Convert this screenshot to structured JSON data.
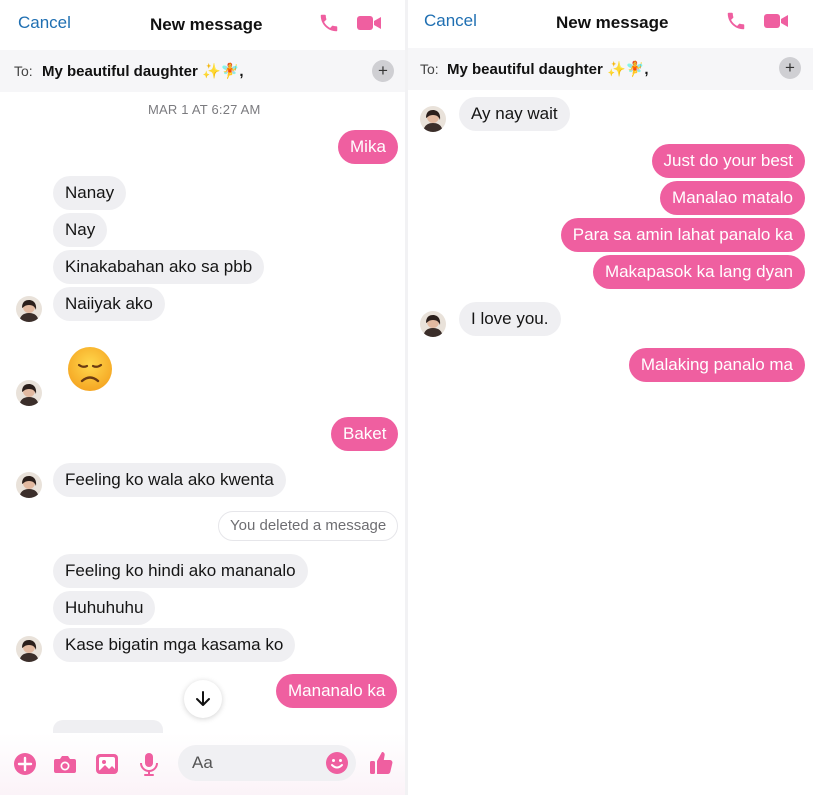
{
  "colors": {
    "accent": "#ef5fa0",
    "link": "#1f6fb2",
    "incoming_bubble": "#efeff2"
  },
  "left": {
    "header": {
      "cancel": "Cancel",
      "title": "New message"
    },
    "to": {
      "label": "To:",
      "recipient": "My beautiful daughter ✨🧚,"
    },
    "timestamp": "MAR 1 AT 6:27 AM",
    "messages": [
      {
        "dir": "out",
        "text": "Mika"
      },
      {
        "dir": "in",
        "text": "Nanay"
      },
      {
        "dir": "in",
        "text": "Nay"
      },
      {
        "dir": "in",
        "text": "Kinakabahan ako sa pbb"
      },
      {
        "dir": "in",
        "text": "Naiiyak ako"
      },
      {
        "dir": "in",
        "emoji": "disappointed-face"
      },
      {
        "dir": "out",
        "text": "Baket"
      },
      {
        "dir": "in",
        "text": "Feeling ko wala ako kwenta"
      },
      {
        "dir": "system",
        "text": "You deleted a message"
      },
      {
        "dir": "in",
        "text": "Feeling ko hindi ako mananalo"
      },
      {
        "dir": "in",
        "text": "Huhuhuhu"
      },
      {
        "dir": "in",
        "text": "Kase bigatin mga kasama ko"
      },
      {
        "dir": "out",
        "text": "Mananalo ka"
      }
    ],
    "composer": {
      "placeholder": "Aa"
    }
  },
  "right": {
    "header": {
      "cancel": "Cancel",
      "title": "New message"
    },
    "to": {
      "label": "To:",
      "recipient": "My beautiful daughter ✨🧚,"
    },
    "messages": [
      {
        "dir": "in",
        "text": "Ay nay wait"
      },
      {
        "dir": "out",
        "text": "Just do your best"
      },
      {
        "dir": "out",
        "text": "Manalao matalo"
      },
      {
        "dir": "out",
        "text": "Para sa amin lahat panalo ka"
      },
      {
        "dir": "out",
        "text": "Makapasok ka lang dyan"
      },
      {
        "dir": "in",
        "text": "I love you."
      },
      {
        "dir": "out",
        "text": "Malaking panalo ma"
      }
    ]
  }
}
